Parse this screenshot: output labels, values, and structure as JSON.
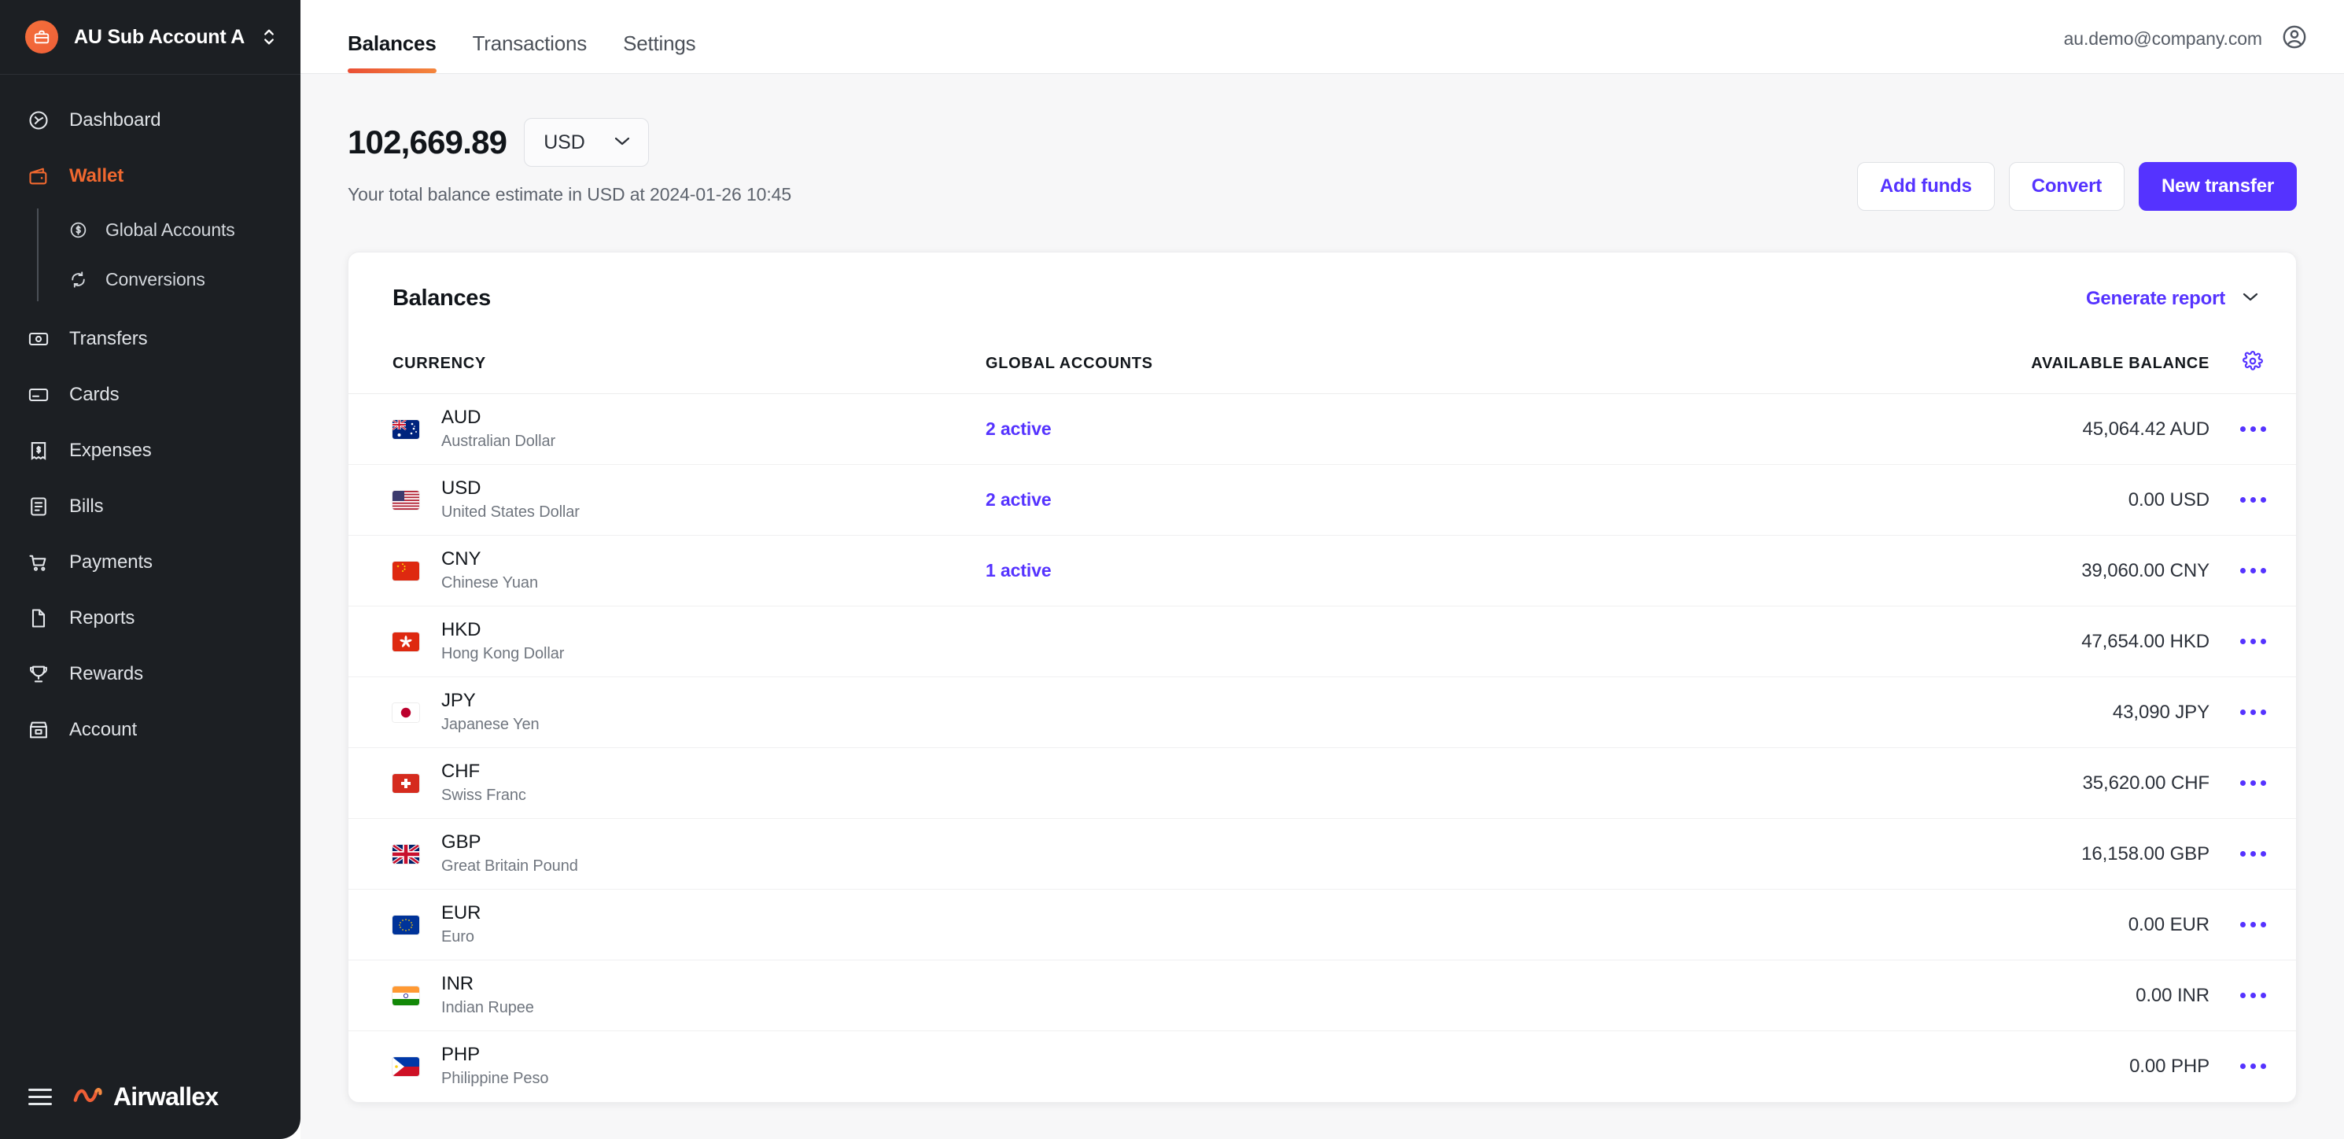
{
  "sidebar": {
    "account": {
      "name": "AU Sub Account A",
      "avatar_icon": "briefcase-icon",
      "switcher_icon": "chevron-updown-icon"
    },
    "items": [
      {
        "label": "Dashboard",
        "icon": "dashboard-icon",
        "active": false
      },
      {
        "label": "Wallet",
        "icon": "wallet-icon",
        "active": true
      },
      {
        "label": "Transfers",
        "icon": "transfers-icon",
        "active": false
      },
      {
        "label": "Cards",
        "icon": "card-icon",
        "active": false
      },
      {
        "label": "Expenses",
        "icon": "receipt-icon",
        "active": false
      },
      {
        "label": "Bills",
        "icon": "bill-icon",
        "active": false
      },
      {
        "label": "Payments",
        "icon": "cart-icon",
        "active": false
      },
      {
        "label": "Reports",
        "icon": "document-icon",
        "active": false
      },
      {
        "label": "Rewards",
        "icon": "trophy-icon",
        "active": false
      },
      {
        "label": "Account",
        "icon": "store-icon",
        "active": false
      }
    ],
    "wallet_subitems": [
      {
        "label": "Global Accounts",
        "icon": "dollar-circle-icon"
      },
      {
        "label": "Conversions",
        "icon": "refresh-icon"
      }
    ],
    "footer": {
      "brand": "Airwallex",
      "menu_icon": "hamburger-icon",
      "logo_icon": "airwallex-logo-icon"
    }
  },
  "topbar": {
    "tabs": [
      {
        "label": "Balances",
        "active": true
      },
      {
        "label": "Transactions",
        "active": false
      },
      {
        "label": "Settings",
        "active": false
      }
    ],
    "user_email": "au.demo@company.com",
    "user_icon": "user-circle-icon"
  },
  "summary": {
    "amount": "102,669.89",
    "currency": "USD",
    "currency_chevron": "chevron-down-icon",
    "subtitle": "Your total balance estimate in USD at 2024-01-26 10:45"
  },
  "actions": {
    "add_funds": "Add funds",
    "convert": "Convert",
    "new_transfer": "New transfer"
  },
  "card": {
    "title": "Balances",
    "generate_report": "Generate report",
    "generate_report_chevron": "chevron-down-icon",
    "settings_icon": "gear-icon",
    "columns": {
      "currency": "CURRENCY",
      "global_accounts": "GLOBAL ACCOUNTS",
      "available_balance": "AVAILABLE BALANCE"
    },
    "rows": [
      {
        "code": "AUD",
        "name": "Australian Dollar",
        "flag": "flag-au",
        "global_accounts": "2 active",
        "balance": "45,064.42 AUD",
        "menu_icon": "more-icon"
      },
      {
        "code": "USD",
        "name": "United States Dollar",
        "flag": "flag-us",
        "global_accounts": "2 active",
        "balance": "0.00 USD",
        "menu_icon": "more-icon"
      },
      {
        "code": "CNY",
        "name": "Chinese Yuan",
        "flag": "flag-cn",
        "global_accounts": "1 active",
        "balance": "39,060.00 CNY",
        "menu_icon": "more-icon"
      },
      {
        "code": "HKD",
        "name": "Hong Kong Dollar",
        "flag": "flag-hk",
        "global_accounts": "",
        "balance": "47,654.00 HKD",
        "menu_icon": "more-icon"
      },
      {
        "code": "JPY",
        "name": "Japanese Yen",
        "flag": "flag-jp",
        "global_accounts": "",
        "balance": "43,090 JPY",
        "menu_icon": "more-icon"
      },
      {
        "code": "CHF",
        "name": "Swiss Franc",
        "flag": "flag-ch",
        "global_accounts": "",
        "balance": "35,620.00 CHF",
        "menu_icon": "more-icon"
      },
      {
        "code": "GBP",
        "name": "Great Britain Pound",
        "flag": "flag-gb",
        "global_accounts": "",
        "balance": "16,158.00 GBP",
        "menu_icon": "more-icon"
      },
      {
        "code": "EUR",
        "name": "Euro",
        "flag": "flag-eu",
        "global_accounts": "",
        "balance": "0.00 EUR",
        "menu_icon": "more-icon"
      },
      {
        "code": "INR",
        "name": "Indian Rupee",
        "flag": "flag-in",
        "global_accounts": "",
        "balance": "0.00 INR",
        "menu_icon": "more-icon"
      },
      {
        "code": "PHP",
        "name": "Philippine Peso",
        "flag": "flag-ph",
        "global_accounts": "",
        "balance": "0.00 PHP",
        "menu_icon": "more-icon"
      }
    ]
  },
  "colors": {
    "accent_purple": "#5533ff",
    "brand_orange": "#f0682f",
    "sidebar_bg": "#1c1f23",
    "page_bg": "#f7f7f8"
  }
}
